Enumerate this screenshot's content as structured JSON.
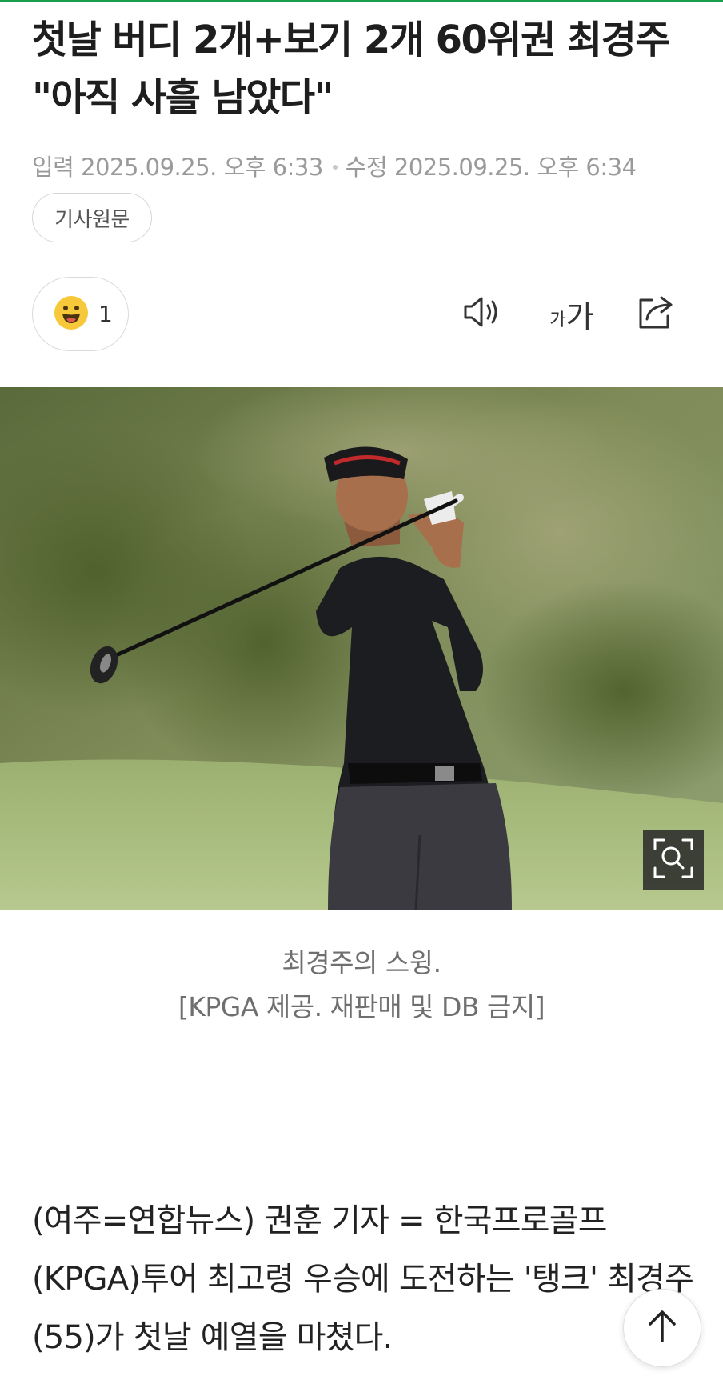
{
  "article": {
    "headline": "첫날 버디 2개+보기 2개 60위권 최경주 \"아직 사흘 남았다\"",
    "published_label": "입력",
    "published_time": "2025.09.25. 오후 6:33",
    "modified_label": "수정",
    "modified_time": "2025.09.25. 오후 6:34",
    "origin_button": "기사원문"
  },
  "toolbar": {
    "reaction_count": "1",
    "reaction_icon": "smiley-face-icon",
    "tts_icon": "speaker-icon",
    "font_size_small": "가",
    "font_size_large": "가",
    "share_icon": "share-icon"
  },
  "photo": {
    "subject": "golfer-swing-photo",
    "zoom_icon": "zoom-search-icon"
  },
  "caption": {
    "line1": "최경주의 스윙.",
    "line2": "[KPGA 제공. 재판매 및 DB 금지]"
  },
  "body": {
    "paragraph1": "(여주=연합뉴스) 권훈 기자 = 한국프로골프(KPGA)투어 최고령 우승에 도전하는 '탱크' 최경주(55)가 첫날 예열을 마쳤다."
  },
  "colors": {
    "accent": "#1a9c4b",
    "meta_text": "#9a9a9a",
    "caption_text": "#6f6f6f"
  }
}
